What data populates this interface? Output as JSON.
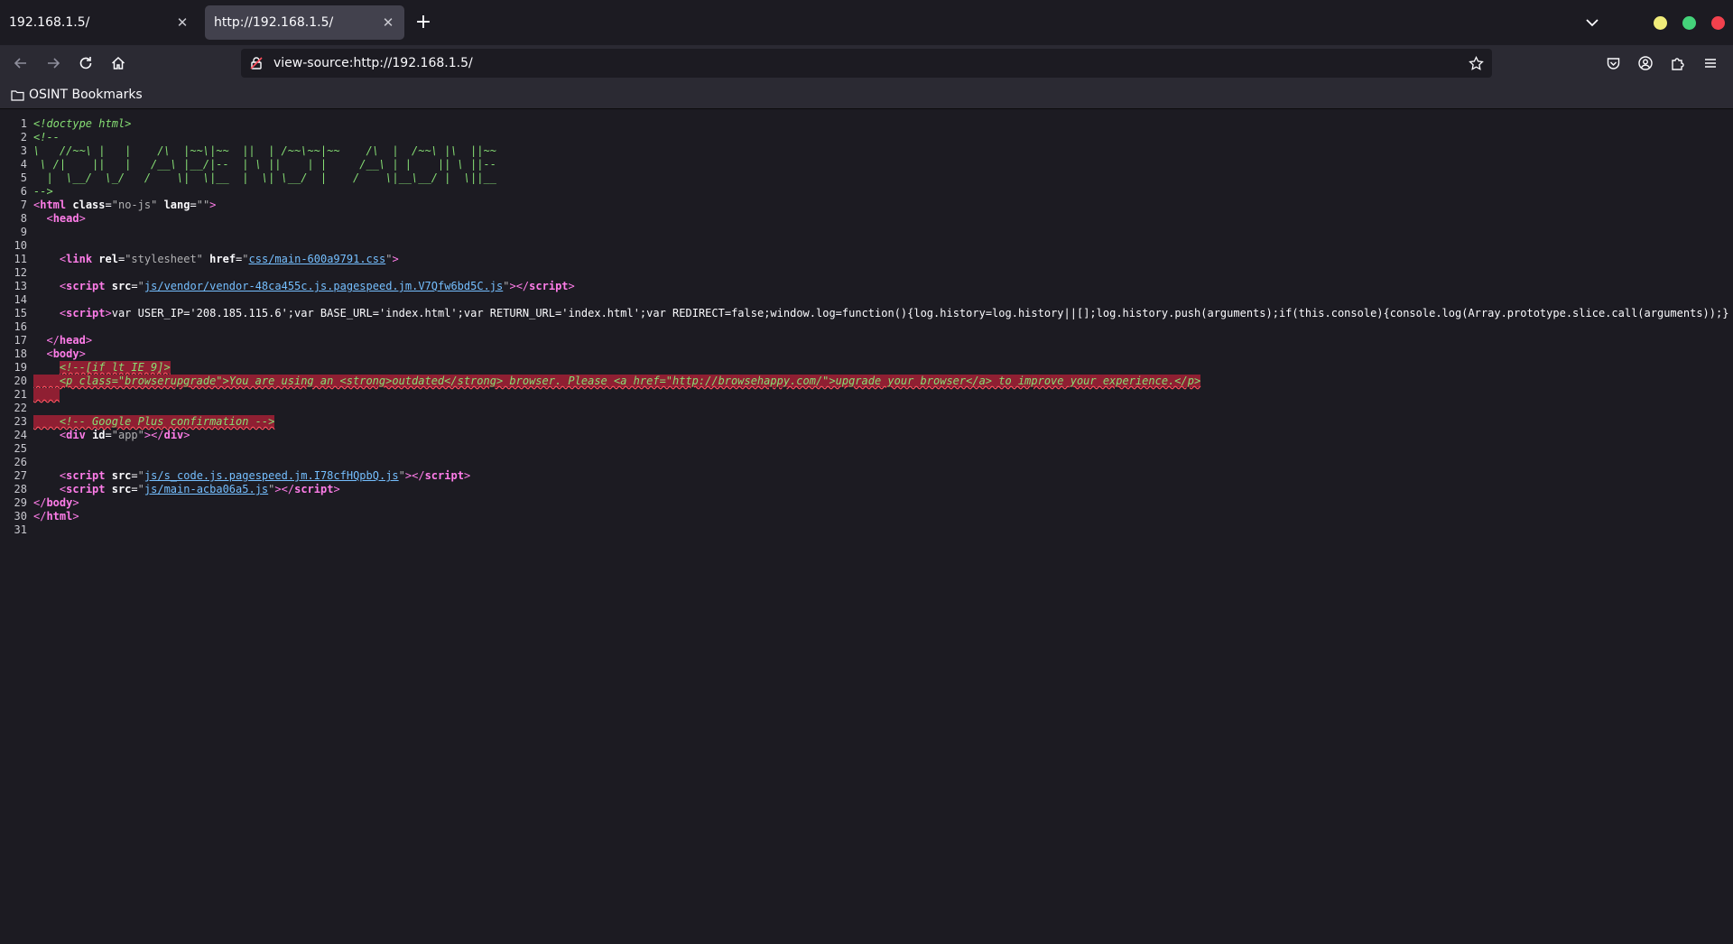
{
  "tabs": [
    {
      "label": "192.168.1.5/",
      "active": false
    },
    {
      "label": "http://192.168.1.5/",
      "active": true
    }
  ],
  "url": "view-source:http://192.168.1.5/",
  "bookmarks": [
    {
      "label": "OSINT Bookmarks"
    }
  ],
  "colors": {
    "close": "#f2414d",
    "maximize": "#44d37a",
    "minimize": "#f0ec7a"
  },
  "source": {
    "l1": "<!doctype html>",
    "l2": "<!--",
    "l3": "\\   //~~\\ |   |    /\\  |~~\\|~~  ||  | /~~\\~~|~~    /\\  |  /~~\\ |\\  ||~~",
    "l4": " \\ /|    ||   |   /__\\ |__/|--  | \\ ||    | |     /__\\ | |    || \\ ||--",
    "l5": "  |  \\__/  \\_/   /    \\|  \\|__  |  \\| \\__/  |    /    \\|__\\__/ |  \\||__",
    "l6": "-->",
    "l7_class": "no-js",
    "l7_lang": "",
    "l11_href": "css/main-600a9791.css",
    "l13_src": "js/vendor/vendor-48ca455c.js.pagespeed.jm.V7Qfw6bd5C.js",
    "l15_script": "var USER_IP='208.185.115.6';var BASE_URL='index.html';var RETURN_URL='index.html';var REDIRECT=false;window.log=function(){log.history=log.history||[];log.history.push(arguments);if(this.console){console.log(Array.prototype.slice.call(arguments));}",
    "l19": "<!--[if lt IE 9]>",
    "l20": "    <p class=\"browserupgrade\">You are using an <strong>outdated</strong> browser. Please <a href=\"http://browsehappy.com/\">upgrade your browser</a> to improve your experience.</p>",
    "l21": "    ",
    "l23": "    <!-- Google Plus confirmation -->",
    "l24_id": "app",
    "l27_src": "js/s_code.js.pagespeed.jm.I78cfHQpbQ.js",
    "l28_src": "js/main-acba06a5.js"
  }
}
